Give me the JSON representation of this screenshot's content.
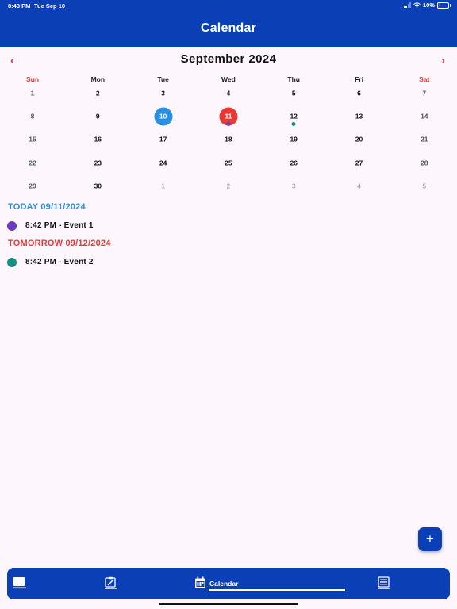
{
  "status_bar": {
    "time": "8:43 PM",
    "date": "Tue Sep 10",
    "battery": "10%",
    "battery_level": 0.1
  },
  "header": {
    "title": "Calendar"
  },
  "calendar": {
    "month_title": "September 2024",
    "prev_icon": "chevron-left-icon",
    "next_icon": "chevron-right-icon",
    "weekdays": [
      "Sun",
      "Mon",
      "Tue",
      "Wed",
      "Thu",
      "Fri",
      "Sat"
    ],
    "weeks": [
      [
        "1",
        "2",
        "3",
        "4",
        "5",
        "6",
        "7"
      ],
      [
        "8",
        "9",
        "10",
        "11",
        "12",
        "13",
        "14"
      ],
      [
        "15",
        "16",
        "17",
        "18",
        "19",
        "20",
        "21"
      ],
      [
        "22",
        "23",
        "24",
        "25",
        "26",
        "27",
        "28"
      ],
      [
        "29",
        "30",
        "1",
        "2",
        "3",
        "4",
        "5"
      ]
    ],
    "today": "10",
    "selected": "11",
    "event_markers": [
      {
        "day": "11",
        "color": "#6a3bbf"
      },
      {
        "day": "12",
        "color": "#138f85"
      }
    ]
  },
  "agenda": {
    "today_label": "TODAY 09/11/2024",
    "tomorrow_label": "TOMORROW 09/12/2024",
    "events": [
      {
        "text": "8:42 PM - Event 1",
        "color": "#6a3bbf"
      },
      {
        "text": "8:42 PM - Event 2",
        "color": "#138f85"
      }
    ]
  },
  "fab": {
    "label": "+"
  },
  "tabbar": {
    "tabs": [
      "book-icon",
      "edit-note-icon",
      "calendar-icon",
      "list-icon"
    ],
    "active_label": "Calendar"
  },
  "colors": {
    "brand": "#0b3fb5",
    "today": "#2a8fe0",
    "selected": "#e53935",
    "weekend_header": "#e53935"
  }
}
